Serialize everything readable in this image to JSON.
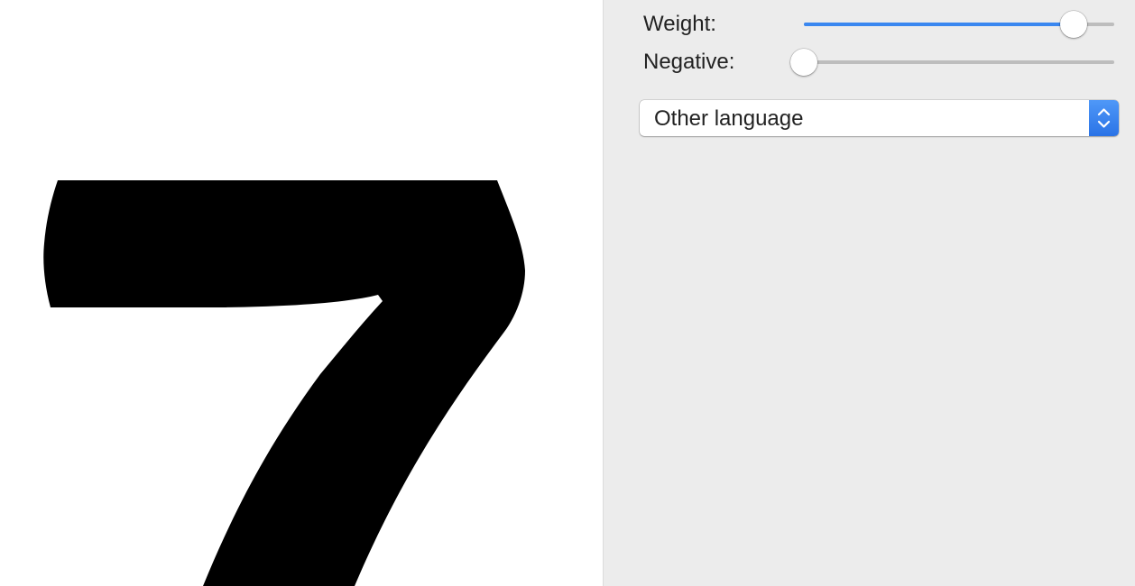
{
  "preview": {
    "glyph": "7",
    "glyph_color": "#000000",
    "background": "#ffffff"
  },
  "controls": {
    "weight": {
      "label": "Weight:",
      "value_fraction": 0.87,
      "accent": "#3a87f0"
    },
    "negative": {
      "label": "Negative:",
      "value_fraction": 0.0
    },
    "language_popup": {
      "selected": "Other language",
      "icon": "up-down-chevrons-icon"
    }
  }
}
